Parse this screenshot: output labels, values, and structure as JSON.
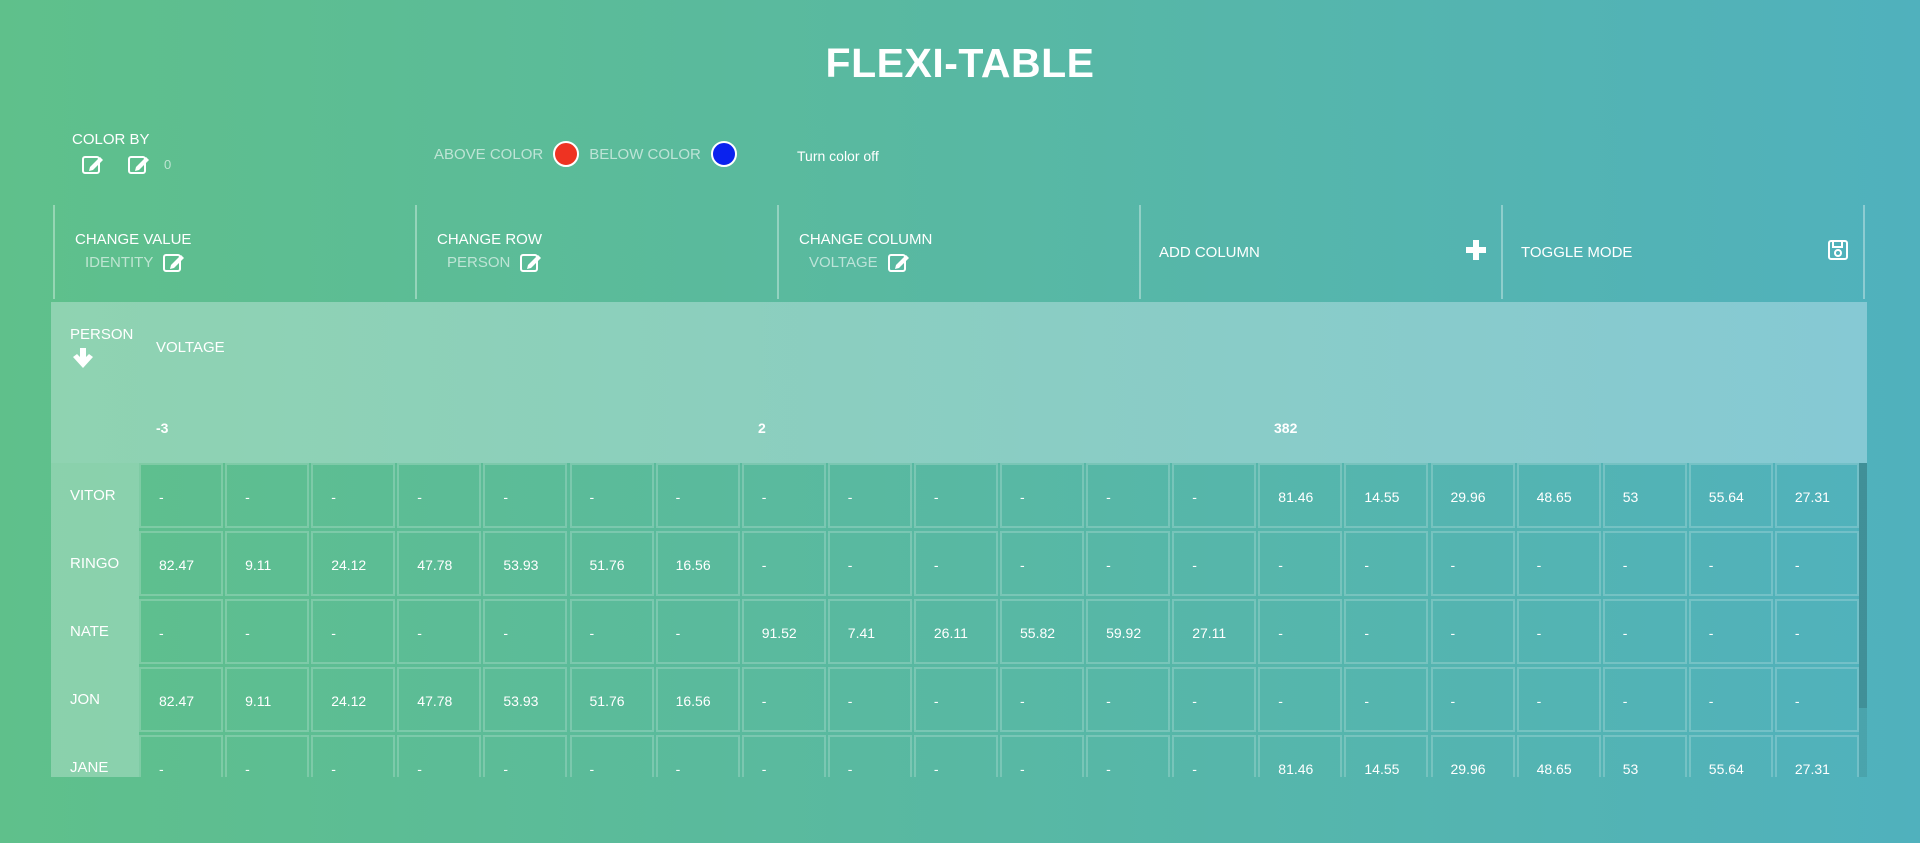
{
  "title": "FLEXI-TABLE",
  "color_by": {
    "label": "COLOR BY",
    "value": "0"
  },
  "color_controls": {
    "above_label": "ABOVE COLOR",
    "above_color": "#ee3322",
    "below_label": "BELOW COLOR",
    "below_color": "#0a22ee",
    "turn_off": "Turn color off"
  },
  "toolbar": {
    "change_value": {
      "label": "CHANGE VALUE",
      "value": "IDENTITY"
    },
    "change_row": {
      "label": "CHANGE ROW",
      "value": "PERSON"
    },
    "change_column": {
      "label": "CHANGE COLUMN",
      "value": "VOLTAGE"
    },
    "add_column": {
      "label": "ADD COLUMN"
    },
    "toggle_mode": {
      "label": "TOGGLE MODE"
    }
  },
  "table": {
    "row_header": "PERSON",
    "column_header": "VOLTAGE",
    "groups": [
      "-3",
      "2",
      "382"
    ],
    "rows": [
      {
        "label": "VITOR",
        "cells": [
          "-",
          "-",
          "-",
          "-",
          "-",
          "-",
          "-",
          "-",
          "-",
          "-",
          "-",
          "-",
          "-",
          "81.46",
          "14.55",
          "29.96",
          "48.65",
          "53",
          "55.64",
          "27.31"
        ]
      },
      {
        "label": "RINGO",
        "cells": [
          "82.47",
          "9.11",
          "24.12",
          "47.78",
          "53.93",
          "51.76",
          "16.56",
          "-",
          "-",
          "-",
          "-",
          "-",
          "-",
          "-",
          "-",
          "-",
          "-",
          "-",
          "-",
          "-"
        ]
      },
      {
        "label": "NATE",
        "cells": [
          "-",
          "-",
          "-",
          "-",
          "-",
          "-",
          "-",
          "91.52",
          "7.41",
          "26.11",
          "55.82",
          "59.92",
          "27.11",
          "-",
          "-",
          "-",
          "-",
          "-",
          "-",
          "-"
        ]
      },
      {
        "label": "JON",
        "cells": [
          "82.47",
          "9.11",
          "24.12",
          "47.78",
          "53.93",
          "51.76",
          "16.56",
          "-",
          "-",
          "-",
          "-",
          "-",
          "-",
          "-",
          "-",
          "-",
          "-",
          "-",
          "-",
          "-"
        ]
      },
      {
        "label": "JANE",
        "cells": [
          "-",
          "-",
          "-",
          "-",
          "-",
          "-",
          "-",
          "-",
          "-",
          "-",
          "-",
          "-",
          "-",
          "81.46",
          "14.55",
          "29.96",
          "48.65",
          "53",
          "55.64",
          "27.31"
        ]
      }
    ]
  },
  "icons": {
    "edit": "pencil-square-icon",
    "add": "plus-icon",
    "save": "floppy-disk-icon",
    "sort": "arrow-down-icon"
  }
}
